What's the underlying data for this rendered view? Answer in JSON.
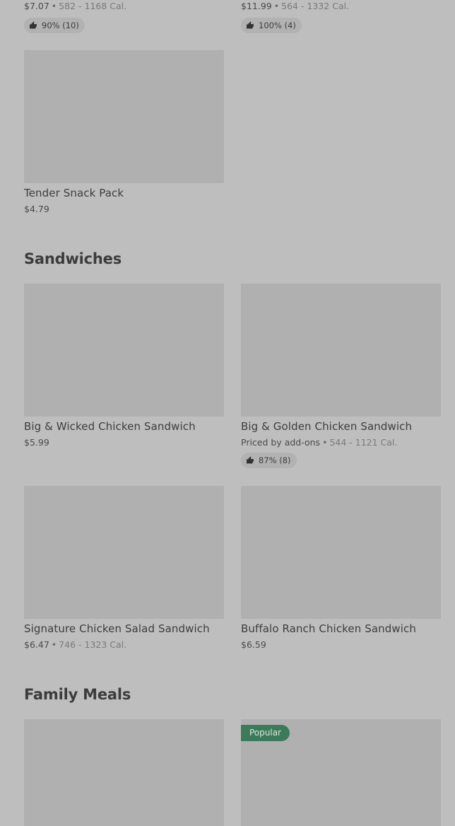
{
  "top_items": [
    {
      "price": "$7.07",
      "calories": "582 - 1168 Cal.",
      "rating": "90% (10)"
    },
    {
      "price": "$11.99",
      "calories": "564 - 1332 Cal.",
      "rating": "100% (4)"
    }
  ],
  "tender_snack": {
    "name": "Tender Snack Pack",
    "price": "$4.79"
  },
  "sandwiches": {
    "title": "Sandwiches",
    "items": [
      {
        "name": "Big & Wicked Chicken Sandwich",
        "price": "$5.99"
      },
      {
        "name": "Big & Golden Chicken Sandwich",
        "price": "Priced by add-ons",
        "calories": "544 - 1121 Cal.",
        "rating": "87% (8)"
      },
      {
        "name": "Signature Chicken Salad Sandwich",
        "price": "$6.47",
        "calories": "746 - 1323 Cal."
      },
      {
        "name": "Buffalo Ranch Chicken Sandwich",
        "price": "$6.59"
      }
    ]
  },
  "family_meals": {
    "title": "Family Meals",
    "popular_badge": "Popular"
  },
  "colors": {
    "background": "#bebebe",
    "image_placeholder": "#b0b0b0",
    "badge": "#3c7a5a"
  },
  "icons": {
    "rating": "thumbs-up-icon"
  }
}
